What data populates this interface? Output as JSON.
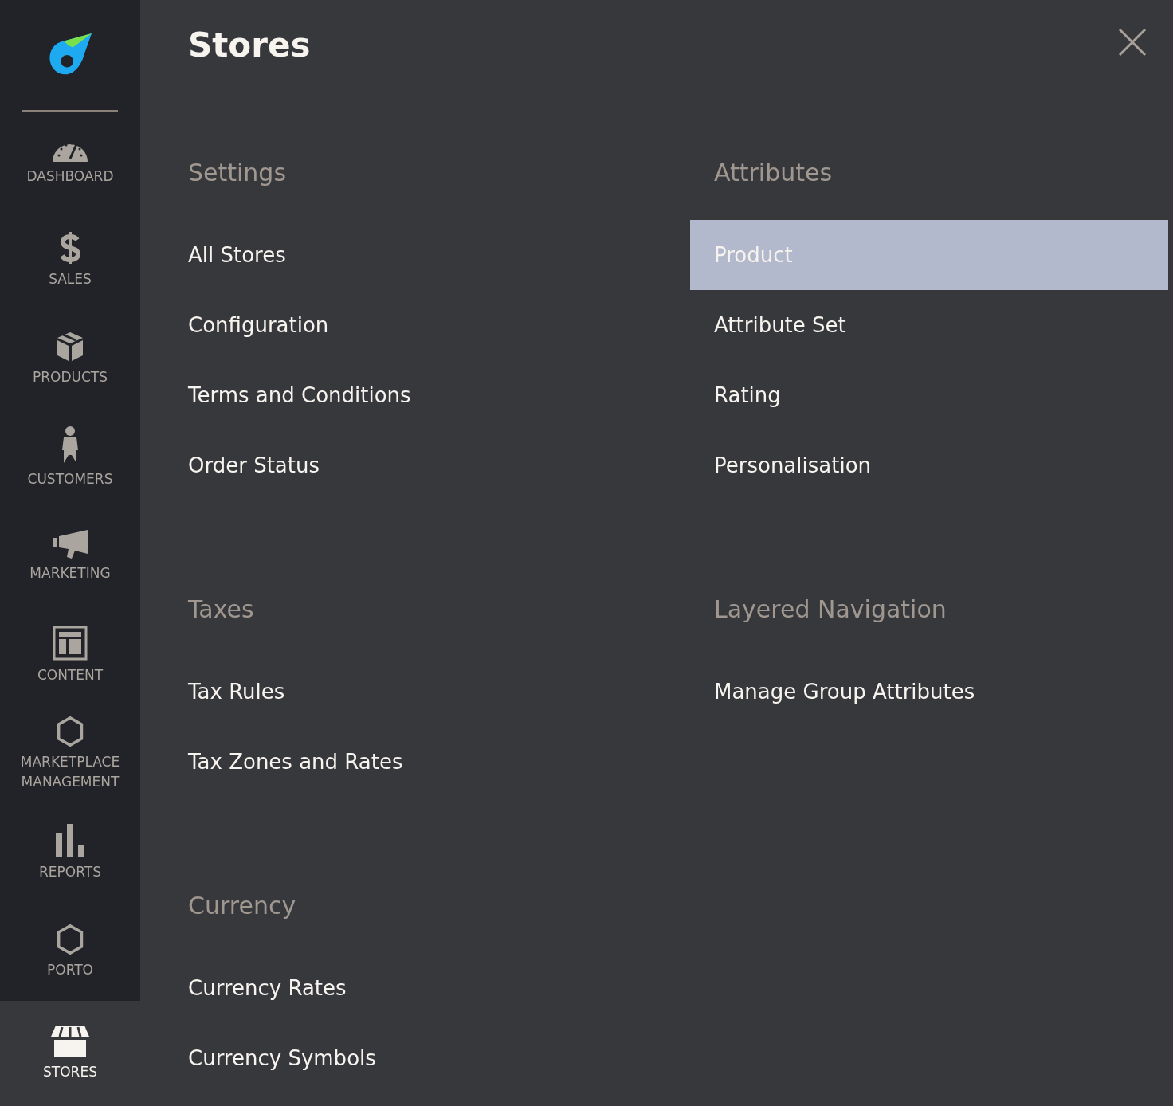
{
  "sidebar": {
    "items": [
      {
        "label": "DASHBOARD",
        "selected": false
      },
      {
        "label": "SALES",
        "selected": false
      },
      {
        "label": "PRODUCTS",
        "selected": false
      },
      {
        "label": "CUSTOMERS",
        "selected": false
      },
      {
        "label": "MARKETING",
        "selected": false
      },
      {
        "label": "CONTENT",
        "selected": false
      },
      {
        "label": "MARKETPLACE MANAGEMENT",
        "selected": false
      },
      {
        "label": "REPORTS",
        "selected": false
      },
      {
        "label": "PORTO",
        "selected": false
      },
      {
        "label": "STORES",
        "selected": true
      }
    ]
  },
  "panel": {
    "title": "Stores",
    "sections": [
      {
        "heading": "Settings",
        "items": [
          {
            "label": "All Stores",
            "selected": false
          },
          {
            "label": "Configuration",
            "selected": false
          },
          {
            "label": "Terms and Conditions",
            "selected": false
          },
          {
            "label": "Order Status",
            "selected": false
          }
        ]
      },
      {
        "heading": "Attributes",
        "items": [
          {
            "label": "Product",
            "selected": true
          },
          {
            "label": "Attribute Set",
            "selected": false
          },
          {
            "label": "Rating",
            "selected": false
          },
          {
            "label": "Personalisation",
            "selected": false
          }
        ]
      },
      {
        "heading": "Taxes",
        "items": [
          {
            "label": "Tax Rules",
            "selected": false
          },
          {
            "label": "Tax Zones and Rates",
            "selected": false
          }
        ]
      },
      {
        "heading": "Layered Navigation",
        "items": [
          {
            "label": "Manage Group Attributes",
            "selected": false
          }
        ]
      },
      {
        "heading": "Currency",
        "items": [
          {
            "label": "Currency Rates",
            "selected": false
          },
          {
            "label": "Currency Symbols",
            "selected": false
          }
        ]
      }
    ]
  }
}
